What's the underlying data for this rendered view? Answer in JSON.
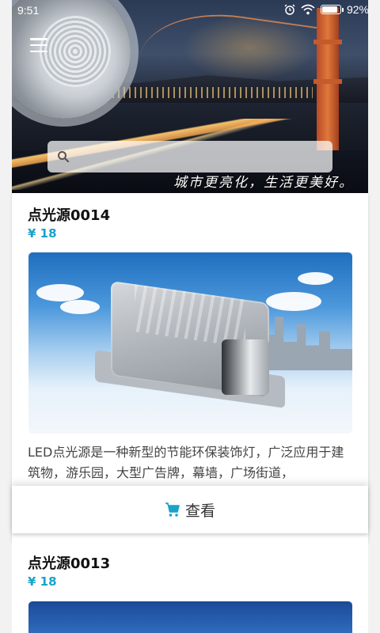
{
  "status_bar": {
    "time": "9:51",
    "battery": "92%"
  },
  "banner": {
    "slogan": "城市更亮化，生活更美好。"
  },
  "search": {
    "placeholder": ""
  },
  "products": [
    {
      "name": "点光源0014",
      "price": "¥ 18",
      "description": "LED点光源是一种新型的节能环保装饰灯，广泛应用于建筑物，游乐园，大型广告牌，幕墙，广场街道，"
    },
    {
      "name": "点光源0013",
      "price": "¥ 18"
    }
  ],
  "actions": {
    "view_label": "查看",
    "cart_icon": "cart-icon"
  },
  "colors": {
    "price": "#1aa2c8",
    "cart_icon": "#1aa2c8"
  }
}
